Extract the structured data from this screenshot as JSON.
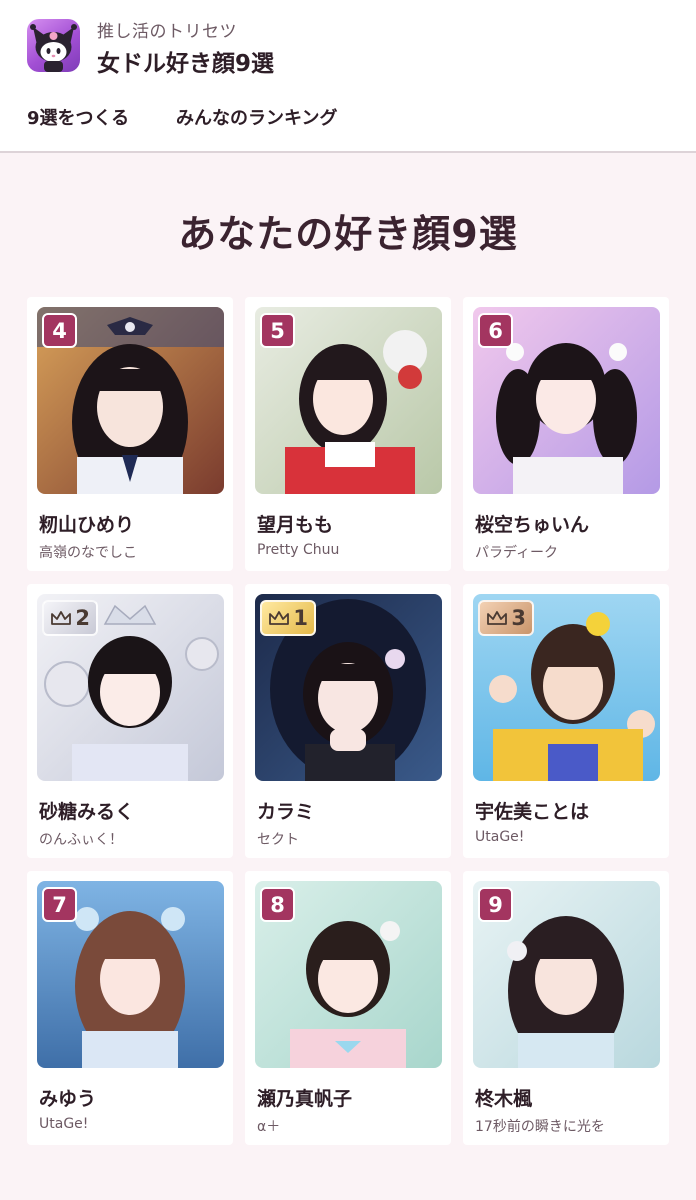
{
  "app": {
    "subtitle": "推し活のトリセツ",
    "title": "女ドル好き顔9選",
    "icon": "kuromi-app-icon"
  },
  "nav": {
    "tabs": [
      {
        "label": "9選をつくる"
      },
      {
        "label": "みんなのランキング"
      }
    ]
  },
  "main": {
    "heading": "あなたの好き顔9選"
  },
  "colors": {
    "accent": "#a33560",
    "background": "#fbf3f6",
    "gold": "#e4b94a",
    "silver": "#c9cad6",
    "bronze": "#c9956b"
  },
  "cards": [
    {
      "rank": "4",
      "badge": "plain",
      "name": "籾山ひめり",
      "group": "高嶺のなでしこ"
    },
    {
      "rank": "5",
      "badge": "plain",
      "name": "望月もも",
      "group": "Pretty Chuu"
    },
    {
      "rank": "6",
      "badge": "plain",
      "name": "桜空ちゅいん",
      "group": "パラディーク"
    },
    {
      "rank": "2",
      "badge": "silver",
      "name": "砂糖みるく",
      "group": "のんふぃく！"
    },
    {
      "rank": "1",
      "badge": "gold",
      "name": "カラミ",
      "group": "セクト"
    },
    {
      "rank": "3",
      "badge": "bronze",
      "name": "宇佐美ことは",
      "group": "UtaGe!"
    },
    {
      "rank": "7",
      "badge": "plain",
      "name": "みゆう",
      "group": "UtaGe!"
    },
    {
      "rank": "8",
      "badge": "plain",
      "name": "瀬乃真帆子",
      "group": "α＋"
    },
    {
      "rank": "9",
      "badge": "plain",
      "name": "柊木楓",
      "group": "17秒前の瞬きに光を"
    }
  ]
}
